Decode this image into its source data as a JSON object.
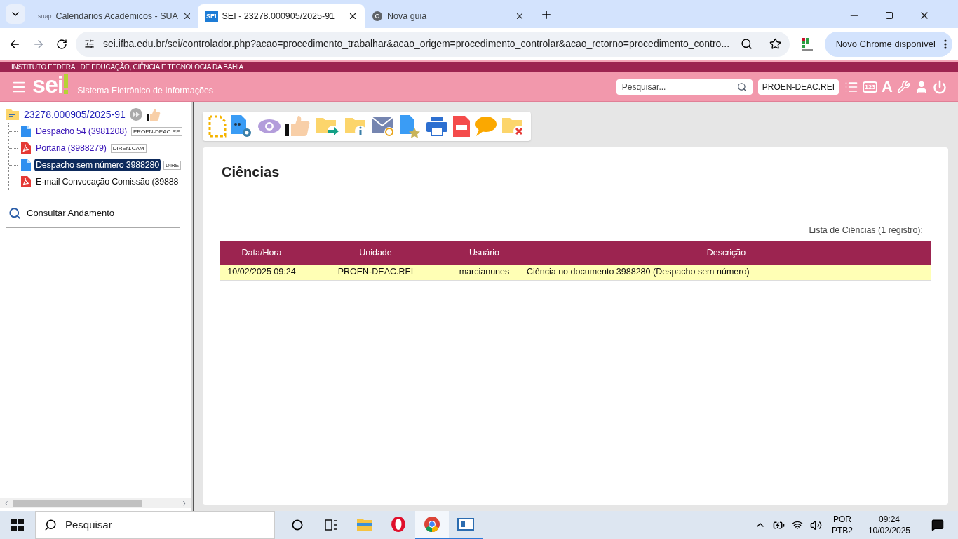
{
  "browser": {
    "tabs": [
      {
        "title": "Calendários Acadêmicos - SUA",
        "kind": "text",
        "icon_text": "suap",
        "selected": false
      },
      {
        "title": "SEI - 23278.000905/2025-91",
        "kind": "text",
        "icon_text": "SEI",
        "selected": true
      },
      {
        "title": "Nova guia",
        "kind": "chrome",
        "selected": false
      }
    ],
    "address": "sei.ifba.edu.br/sei/controlador.php?acao=procedimento_trabalhar&acao_origem=procedimento_controlar&acao_retorno=procedimento_contro...",
    "update_button": "Novo Chrome disponível"
  },
  "header": {
    "institute": "INSTITUTO FEDERAL DE EDUCAÇÃO, CIÊNCIA E TECNOLOGIA DA BAHIA",
    "logo": "sei",
    "system_name": "Sistema Eletrônico de Informações",
    "search": {
      "placeholder": "Pesquisar..."
    },
    "unit": "PROEN-DEAC.REI",
    "glyphs": [
      "123",
      "A"
    ]
  },
  "tree": {
    "process": "23278.000905/2025-91",
    "documents": [
      {
        "label": "Despacho 54 (3981208)",
        "unit_tag": "PROEN-DEAC.RE",
        "kind": "doc",
        "viewed": true,
        "selected": false
      },
      {
        "label": "Portaria (3988279)",
        "unit_tag": "DIREN.CAM",
        "kind": "pdf",
        "viewed": true,
        "selected": false
      },
      {
        "label": "Despacho sem número 3988280",
        "unit_tag": "DIRE",
        "kind": "doc",
        "viewed": true,
        "selected": true
      },
      {
        "label": "E-mail Convocação Comissão (39888",
        "kind": "pdf",
        "viewed": false,
        "selected": false
      }
    ],
    "link": "Consultar Andamento"
  },
  "content": {
    "title": "Ciências",
    "caption": "Lista de Ciências (1 registro):",
    "columns": [
      "Data/Hora",
      "Unidade",
      "Usuário",
      "Descrição"
    ],
    "rows": [
      [
        "10/02/2025 09:24",
        "PROEN-DEAC.REI",
        "marcianunes",
        "Ciência no documento 3988280 (Despacho sem número)"
      ]
    ]
  },
  "taskbar": {
    "search": {
      "placeholder": "Pesquisar"
    },
    "apps": [
      {
        "kind": "explorer",
        "selected": false
      },
      {
        "kind": "opera",
        "selected": false
      },
      {
        "kind": "chrome",
        "selected": true
      },
      {
        "kind": "app",
        "selected": false
      }
    ],
    "language": "POR",
    "layout": "PTB2",
    "time": "09:24",
    "date": "10/02/2025"
  }
}
